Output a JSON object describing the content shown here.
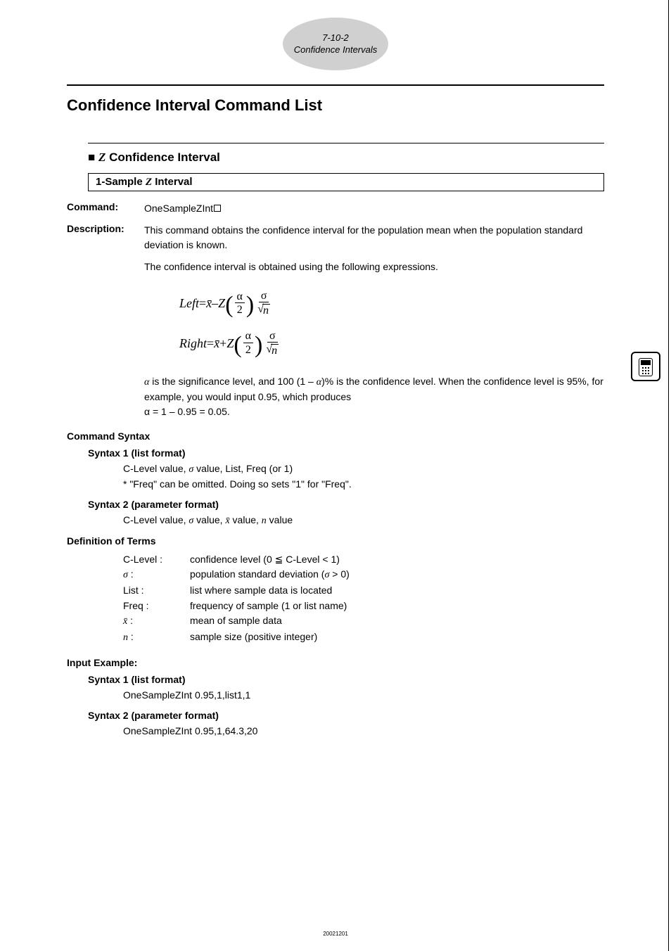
{
  "page_badge": {
    "num": "7-10-2",
    "title": "Confidence Intervals"
  },
  "title": "Confidence Interval Command List",
  "z_heading_prefix": "■ ",
  "z_heading_var": "Z",
  "z_heading_suffix": " Confidence Interval",
  "method_prefix": "1-Sample ",
  "method_var": "Z",
  "method_suffix": " Interval",
  "command_label": "Command:",
  "command_value": "OneSampleZInt",
  "description_label": "Description:",
  "description_p1": "This command obtains the confidence interval for the population mean when the population standard deviation is known.",
  "description_p2": "The confidence interval is obtained using the following expressions.",
  "formula": {
    "left_lhs": "Left",
    "right_lhs": "Right",
    "eq": " = ",
    "xbar": "x̄",
    "minus": " – ",
    "plus": " + ",
    "Z": "Z",
    "alpha": "α",
    "two": "2",
    "sigma": "σ",
    "n": "n"
  },
  "alpha_text_1a": "α",
  "alpha_text_1b": " is the significance level, and 100 (1 – ",
  "alpha_text_1c": "α",
  "alpha_text_1d": ")% is the confidence level. When the confidence level is 95%, for example, you would input 0.95, which produces",
  "alpha_text_2": "α = 1 – 0.95 = 0.05.",
  "command_syntax_head": "Command Syntax",
  "syntax1_head": "Syntax 1 (list format)",
  "syntax1_line1a": "C-Level value, ",
  "syntax1_line1_sigma": "σ",
  "syntax1_line1b": " value, List, Freq (or 1)",
  "syntax1_line2": "* \"Freq\" can be omitted. Doing so sets \"1\" for \"Freq\".",
  "syntax2_head": "Syntax 2 (parameter format)",
  "syntax2_line_a": "C-Level value, ",
  "syntax2_sigma": "σ",
  "syntax2_line_b": " value, ",
  "syntax2_xbar": "x̄",
  "syntax2_line_c": " value, ",
  "syntax2_n": "n",
  "syntax2_line_d": " value",
  "def_terms_head": "Definition of Terms",
  "terms": [
    {
      "k": "C-Level :",
      "v": "confidence level (0 ≦ C-Level < 1)"
    },
    {
      "k_ital": "σ",
      "k_suffix": " :",
      "v_a": "population standard deviation (",
      "v_ital": "σ",
      "v_b": " > 0)"
    },
    {
      "k": "List :",
      "v": "list where sample data is located"
    },
    {
      "k": "Freq :",
      "v": "frequency of sample (1 or list name)"
    },
    {
      "k_ital": "x̄",
      "k_suffix": " :",
      "v": "mean of sample data"
    },
    {
      "k_ital": "n",
      "k_suffix": " :",
      "v": "sample size (positive integer)"
    }
  ],
  "input_example_head": "Input Example:",
  "ie_syntax1_head": "Syntax 1 (list format)",
  "ie_syntax1_val": "OneSampleZInt  0.95,1,list1,1",
  "ie_syntax2_head": "Syntax 2 (parameter format)",
  "ie_syntax2_val": "OneSampleZInt  0.95,1,64.3,20",
  "footer": "20021201"
}
